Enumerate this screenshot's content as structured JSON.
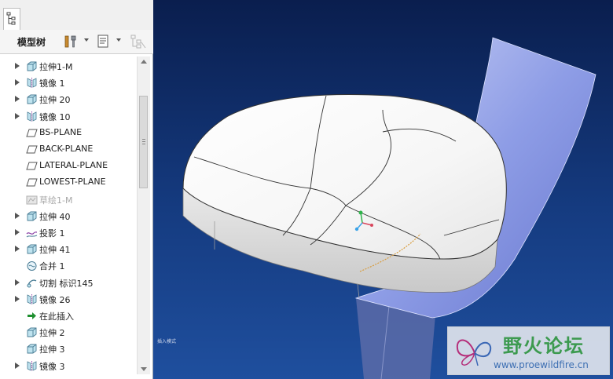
{
  "panel": {
    "toolbar_title": "模型树"
  },
  "tree": {
    "items": [
      {
        "label": "拉伸1-M",
        "icon": "extrude-icon",
        "expandable": true
      },
      {
        "label": "镜像 1",
        "icon": "mirror-icon",
        "expandable": true
      },
      {
        "label": "拉伸 20",
        "icon": "extrude-icon",
        "expandable": true
      },
      {
        "label": "镜像 10",
        "icon": "mirror-icon",
        "expandable": true
      },
      {
        "label": "BS-PLANE",
        "icon": "datum-plane-icon",
        "expandable": false
      },
      {
        "label": "BACK-PLANE",
        "icon": "datum-plane-icon",
        "expandable": false
      },
      {
        "label": "LATERAL-PLANE",
        "icon": "datum-plane-icon",
        "expandable": false
      },
      {
        "label": "LOWEST-PLANE",
        "icon": "datum-plane-icon",
        "expandable": false
      },
      {
        "label": "草绘1-M",
        "icon": "sketch-icon",
        "expandable": false,
        "dim": true
      },
      {
        "label": "拉伸 40",
        "icon": "extrude-icon",
        "expandable": true
      },
      {
        "label": "投影 1",
        "icon": "projection-icon",
        "expandable": true
      },
      {
        "label": "拉伸 41",
        "icon": "extrude-icon",
        "expandable": true
      },
      {
        "label": "合并 1",
        "icon": "merge-icon",
        "expandable": false
      },
      {
        "label": "切割 标识145",
        "icon": "cut-icon",
        "expandable": true
      },
      {
        "label": "镜像 26",
        "icon": "mirror-icon",
        "expandable": true
      },
      {
        "label": "在此插入",
        "icon": "insert-here-icon",
        "expandable": false
      },
      {
        "label": "拉伸 2",
        "icon": "extrude-icon",
        "expandable": false
      },
      {
        "label": "拉伸 3",
        "icon": "extrude-icon",
        "expandable": false
      },
      {
        "label": "镜像 3",
        "icon": "mirror-icon",
        "expandable": true
      }
    ]
  },
  "viewport": {
    "status_note": "插入模式"
  },
  "watermark": {
    "name": "野火论坛",
    "url": "www.proewildfire.cn"
  },
  "colors": {
    "viewport_top": "#0a1e4e",
    "viewport_bottom": "#1f4f9e",
    "surface_blue": "#8e9de6",
    "model_white": "#f4f4f4",
    "watermark_green": "#3c9a4f"
  }
}
